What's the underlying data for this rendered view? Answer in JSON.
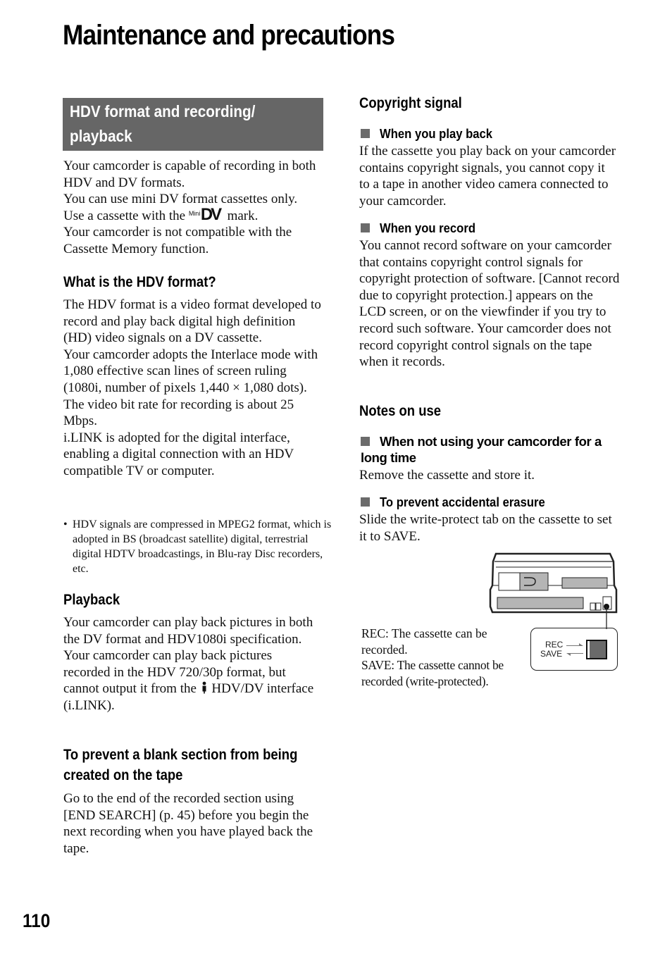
{
  "page": {
    "title": "Maintenance and precautions",
    "page_number": "110"
  },
  "left": {
    "banner": {
      "line1": "HDV format and recording/",
      "line2": "playback"
    },
    "intro": {
      "line1": "Your camcorder is capable of recording in both HDV and DV formats.",
      "line2": "You can use mini DV format cassettes only.",
      "line3_before": "Use a cassette with the",
      "line3_logo_small": "Mini",
      "line3_logo_big": "DV",
      "line3_after": "mark.",
      "line4": "Your camcorder is not compatible with the Cassette Memory function."
    },
    "hdv_format": {
      "heading": "What is the HDV format?",
      "p1": "The HDV format is a video format developed to record and play back digital high definition (HD) video signals on a DV cassette.",
      "p2": "Your camcorder adopts the Interlace mode with 1,080 effective scan lines of screen ruling (1080i, number of pixels 1,440 × 1,080 dots).",
      "p3": "The video bit rate for recording is about 25 Mbps.",
      "p4": "i.LINK is adopted for the digital interface, enabling a digital connection with an HDV compatible TV or computer.",
      "note_bullet": "•",
      "note": "HDV signals are compressed in MPEG2 format, which is adopted in BS (broadcast satellite) digital, terrestrial digital HDTV broadcastings, in Blu-ray Disc recorders, etc."
    },
    "playback": {
      "heading": "Playback",
      "p1": "Your camcorder can play back pictures in both the DV format and HDV1080i specification.",
      "p2_before": "Your camcorder can play back pictures recorded in the HDV 720/30p format, but cannot output it from the",
      "p2_after": "HDV/DV interface (i.LINK)."
    },
    "blank_section": {
      "heading_line1": "To prevent a blank section from being",
      "heading_line2": "created on the tape",
      "p1": "Go to the end of the recorded section using [END SEARCH] (p. 45) before you begin the next recording when you have played back the tape."
    }
  },
  "right": {
    "copyright": {
      "heading": "Copyright signal",
      "play_back": {
        "heading": "When you play back",
        "text": "If the cassette you play back on your camcorder contains copyright signals, you cannot copy it to a tape in another video camera connected to your camcorder."
      },
      "record": {
        "heading": "When you record",
        "text": "You cannot record software on your camcorder that contains copyright control signals for copyright protection of software. [Cannot record due to copyright protection.] appears on the LCD screen, or on the viewfinder if you try to record such software. Your camcorder does not record copyright control signals on the tape when it records."
      }
    },
    "notes": {
      "heading": "Notes on use",
      "not_using": {
        "heading": "When not using your camcorder for a long time",
        "text": "Remove the cassette and store it."
      },
      "erasure": {
        "heading": "To prevent accidental erasure",
        "text": "Slide the write-protect tab on the cassette to set it to SAVE."
      }
    },
    "figure": {
      "caption_rec": "REC: The cassette can be recorded.",
      "caption_save": "SAVE: The cassette cannot be recorded (write-protected).",
      "switch_rec_label": "REC",
      "switch_save_label": "SAVE"
    }
  }
}
